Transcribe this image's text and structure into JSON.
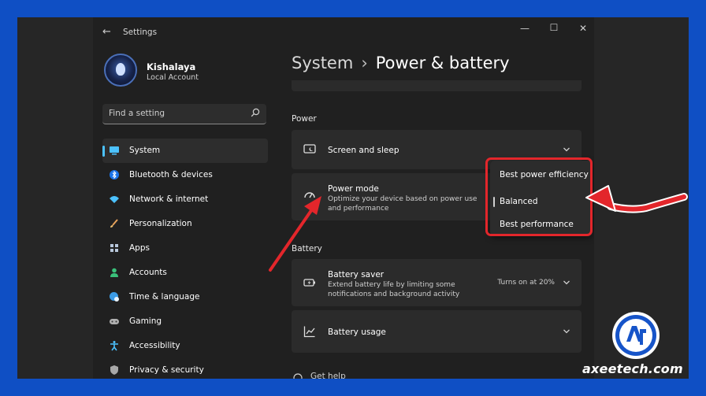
{
  "window": {
    "title": "Settings"
  },
  "user": {
    "name": "Kishalaya",
    "account": "Local Account"
  },
  "search": {
    "placeholder": "Find a setting"
  },
  "sidebar": {
    "items": [
      {
        "label": "System",
        "icon": "monitor-icon"
      },
      {
        "label": "Bluetooth & devices",
        "icon": "bluetooth-icon"
      },
      {
        "label": "Network & internet",
        "icon": "wifi-icon"
      },
      {
        "label": "Personalization",
        "icon": "brush-icon"
      },
      {
        "label": "Apps",
        "icon": "apps-icon"
      },
      {
        "label": "Accounts",
        "icon": "person-icon"
      },
      {
        "label": "Time & language",
        "icon": "globe-clock-icon"
      },
      {
        "label": "Gaming",
        "icon": "gamepad-icon"
      },
      {
        "label": "Accessibility",
        "icon": "accessibility-icon"
      },
      {
        "label": "Privacy & security",
        "icon": "shield-icon"
      }
    ]
  },
  "header": {
    "section": "System",
    "page": "Power & battery"
  },
  "power": {
    "label": "Power",
    "screen_sleep": "Screen and sleep",
    "mode_title": "Power mode",
    "mode_desc": "Optimize your device based on power use and performance"
  },
  "dropdown": {
    "options": [
      "Best power efficiency",
      "Balanced",
      "Best performance"
    ],
    "selected": "Balanced"
  },
  "battery": {
    "label": "Battery",
    "saver_title": "Battery saver",
    "saver_desc": "Extend battery life by limiting some notifications and background activity",
    "saver_status": "Turns on at 20%",
    "usage_title": "Battery usage"
  },
  "footer": {
    "get_help": "Get help"
  },
  "watermark": {
    "site": "axeetech.com"
  },
  "colors": {
    "accent": "#4cc2ff",
    "highlight": "#e3262b",
    "frame": "#0f4fc4"
  }
}
